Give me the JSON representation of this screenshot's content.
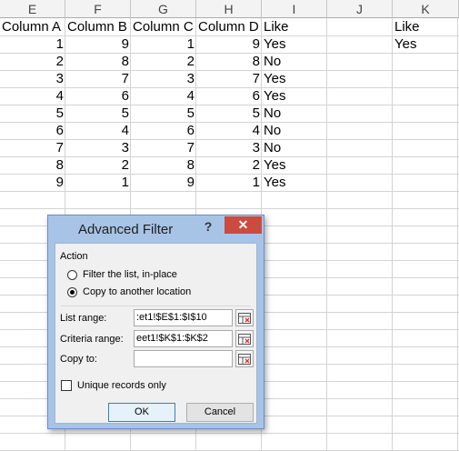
{
  "sheet": {
    "columns": [
      "E",
      "F",
      "G",
      "H",
      "I",
      "J",
      "K"
    ],
    "headers": {
      "e": "Column A",
      "f": "Column B",
      "g": "Column C",
      "h": "Column D",
      "i": "Like",
      "k": "Like"
    },
    "criteria_value": "Yes",
    "rows": [
      {
        "a": "1",
        "b": "9",
        "c": "1",
        "d": "9",
        "like": "Yes"
      },
      {
        "a": "2",
        "b": "8",
        "c": "2",
        "d": "8",
        "like": "No"
      },
      {
        "a": "3",
        "b": "7",
        "c": "3",
        "d": "7",
        "like": "Yes"
      },
      {
        "a": "4",
        "b": "6",
        "c": "4",
        "d": "6",
        "like": "Yes"
      },
      {
        "a": "5",
        "b": "5",
        "c": "5",
        "d": "5",
        "like": "No"
      },
      {
        "a": "6",
        "b": "4",
        "c": "6",
        "d": "4",
        "like": "No"
      },
      {
        "a": "7",
        "b": "3",
        "c": "7",
        "d": "3",
        "like": "No"
      },
      {
        "a": "8",
        "b": "2",
        "c": "8",
        "d": "2",
        "like": "Yes"
      },
      {
        "a": "9",
        "b": "1",
        "c": "9",
        "d": "1",
        "like": "Yes"
      }
    ]
  },
  "dialog": {
    "title": "Advanced Filter",
    "help": "?",
    "close": "✕",
    "action_label": "Action",
    "option_filter": "Filter the list, in-place",
    "option_copy": "Copy to another location",
    "selected_option": "copy",
    "list_range_label": "List range:",
    "list_range_value": ":et1!$E$1:$I$10",
    "criteria_range_label": "Criteria range:",
    "criteria_range_value": "eet1!$K$1:$K$2",
    "copy_to_label": "Copy to:",
    "copy_to_value": "",
    "unique_label": "Unique records only",
    "unique_checked": false,
    "ok": "OK",
    "cancel": "Cancel",
    "colors": {
      "titlebar": "#a7c4e7",
      "close": "#c94c3f"
    }
  }
}
